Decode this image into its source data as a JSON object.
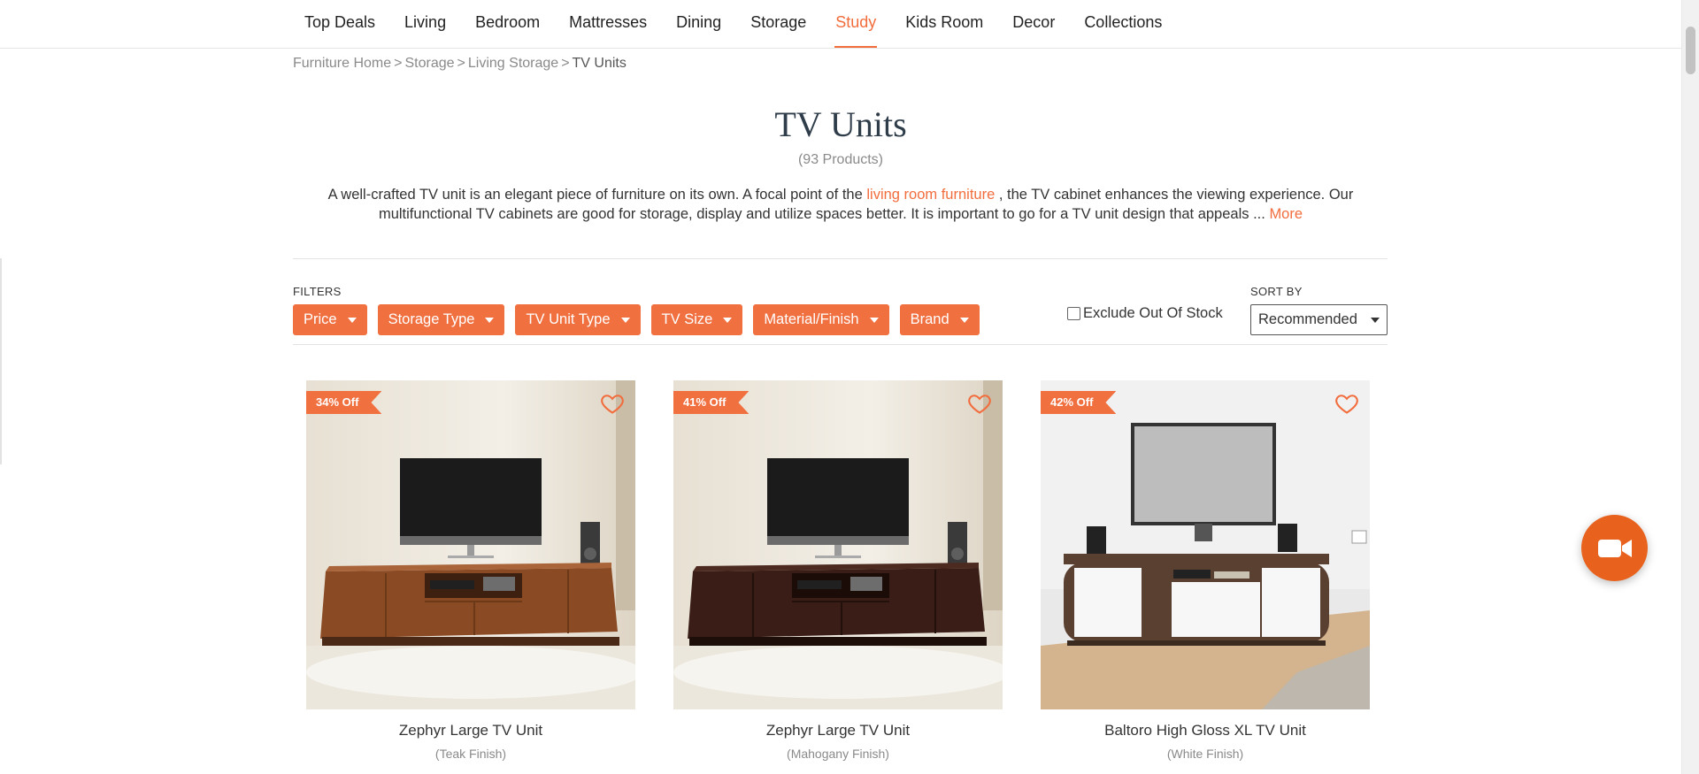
{
  "nav": {
    "items": [
      {
        "label": "Top Deals"
      },
      {
        "label": "Living"
      },
      {
        "label": "Bedroom"
      },
      {
        "label": "Mattresses"
      },
      {
        "label": "Dining"
      },
      {
        "label": "Storage"
      },
      {
        "label": "Study"
      },
      {
        "label": "Kids Room"
      },
      {
        "label": "Decor"
      },
      {
        "label": "Collections"
      }
    ],
    "active": "Study"
  },
  "breadcrumb": {
    "items": [
      "Furniture Home",
      "Storage",
      "Living Storage"
    ],
    "current": "TV Units",
    "separator": ">"
  },
  "page": {
    "title": "TV Units",
    "count": "(93 Products)",
    "desc_part1": "A well-crafted TV unit is an elegant piece of furniture on its own. A focal point of the ",
    "desc_link": "living room furniture",
    "desc_part2": " , the TV cabinet enhances the viewing experience. Our multifunctional TV cabinets are good for storage, display and utilize spaces better. It is important to go for a TV unit design that appeals ... ",
    "desc_more": "More"
  },
  "filters": {
    "label": "FILTERS",
    "buttons": [
      "Price",
      "Storage Type",
      "TV Unit Type",
      "TV Size",
      "Material/Finish",
      "Brand"
    ],
    "exclude_label": "Exclude Out Of Stock",
    "sort_label": "SORT BY",
    "sort_value": "Recommended"
  },
  "products": [
    {
      "badge": "34% Off",
      "name": "Zephyr Large TV Unit",
      "finish": "(Teak Finish)"
    },
    {
      "badge": "41% Off",
      "name": "Zephyr Large TV Unit",
      "finish": "(Mahogany Finish)"
    },
    {
      "badge": "42% Off",
      "name": "Baltoro High Gloss XL TV Unit",
      "finish": "(White Finish)"
    }
  ],
  "colors": {
    "accent": "#f26d3d",
    "teak": "#8a4a24",
    "mahogany": "#3a1d16",
    "white_gloss": "#f4f4f4"
  }
}
